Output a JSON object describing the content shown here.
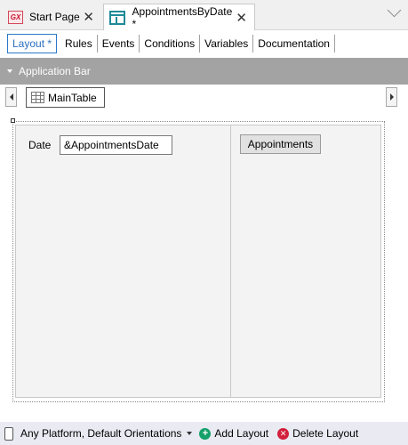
{
  "tabs": [
    {
      "label": "Start Page",
      "icon": "gx-icon",
      "active": false
    },
    {
      "label": "AppointmentsByDate *",
      "icon": "webpanel-icon",
      "active": true
    }
  ],
  "sub_tabs": [
    "Layout *",
    "Rules",
    "Events",
    "Conditions",
    "Variables",
    "Documentation"
  ],
  "app_bar": {
    "label": "Application Bar"
  },
  "breadcrumb": {
    "table_label": "MainTable"
  },
  "form": {
    "date_label": "Date",
    "date_input_value": "&AppointmentsDate",
    "button_label": "Appointments"
  },
  "bottom_bar": {
    "platform_label": "Any Platform, Default Orientations",
    "add_layout_label": "Add Layout",
    "delete_layout_label": "Delete Layout"
  },
  "colors": {
    "active_tab_accent": "#2a6fc0",
    "app_bar_bg": "#a3a3a3",
    "add_icon": "#15a06a",
    "delete_icon": "#d21f3c"
  }
}
